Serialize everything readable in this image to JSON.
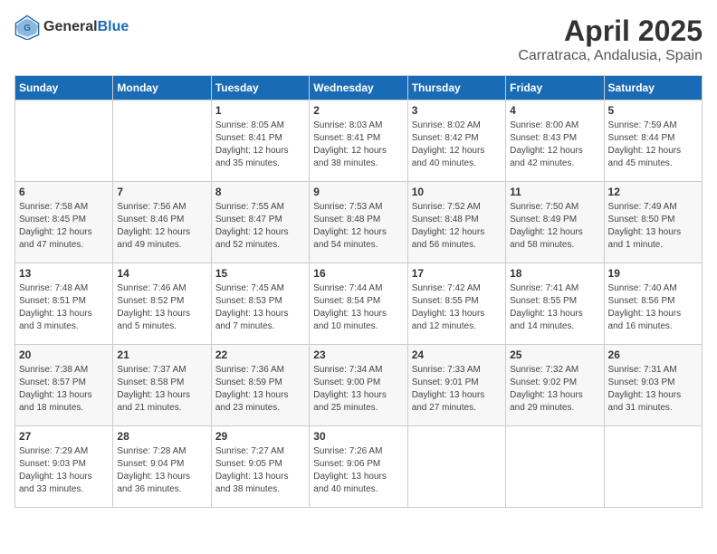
{
  "logo": {
    "general": "General",
    "blue": "Blue"
  },
  "header": {
    "title": "April 2025",
    "subtitle": "Carratraca, Andalusia, Spain"
  },
  "days_of_week": [
    "Sunday",
    "Monday",
    "Tuesday",
    "Wednesday",
    "Thursday",
    "Friday",
    "Saturday"
  ],
  "weeks": [
    [
      {
        "day": "",
        "sunrise": "",
        "sunset": "",
        "daylight": ""
      },
      {
        "day": "",
        "sunrise": "",
        "sunset": "",
        "daylight": ""
      },
      {
        "day": "1",
        "sunrise": "Sunrise: 8:05 AM",
        "sunset": "Sunset: 8:41 PM",
        "daylight": "Daylight: 12 hours and 35 minutes."
      },
      {
        "day": "2",
        "sunrise": "Sunrise: 8:03 AM",
        "sunset": "Sunset: 8:41 PM",
        "daylight": "Daylight: 12 hours and 38 minutes."
      },
      {
        "day": "3",
        "sunrise": "Sunrise: 8:02 AM",
        "sunset": "Sunset: 8:42 PM",
        "daylight": "Daylight: 12 hours and 40 minutes."
      },
      {
        "day": "4",
        "sunrise": "Sunrise: 8:00 AM",
        "sunset": "Sunset: 8:43 PM",
        "daylight": "Daylight: 12 hours and 42 minutes."
      },
      {
        "day": "5",
        "sunrise": "Sunrise: 7:59 AM",
        "sunset": "Sunset: 8:44 PM",
        "daylight": "Daylight: 12 hours and 45 minutes."
      }
    ],
    [
      {
        "day": "6",
        "sunrise": "Sunrise: 7:58 AM",
        "sunset": "Sunset: 8:45 PM",
        "daylight": "Daylight: 12 hours and 47 minutes."
      },
      {
        "day": "7",
        "sunrise": "Sunrise: 7:56 AM",
        "sunset": "Sunset: 8:46 PM",
        "daylight": "Daylight: 12 hours and 49 minutes."
      },
      {
        "day": "8",
        "sunrise": "Sunrise: 7:55 AM",
        "sunset": "Sunset: 8:47 PM",
        "daylight": "Daylight: 12 hours and 52 minutes."
      },
      {
        "day": "9",
        "sunrise": "Sunrise: 7:53 AM",
        "sunset": "Sunset: 8:48 PM",
        "daylight": "Daylight: 12 hours and 54 minutes."
      },
      {
        "day": "10",
        "sunrise": "Sunrise: 7:52 AM",
        "sunset": "Sunset: 8:48 PM",
        "daylight": "Daylight: 12 hours and 56 minutes."
      },
      {
        "day": "11",
        "sunrise": "Sunrise: 7:50 AM",
        "sunset": "Sunset: 8:49 PM",
        "daylight": "Daylight: 12 hours and 58 minutes."
      },
      {
        "day": "12",
        "sunrise": "Sunrise: 7:49 AM",
        "sunset": "Sunset: 8:50 PM",
        "daylight": "Daylight: 13 hours and 1 minute."
      }
    ],
    [
      {
        "day": "13",
        "sunrise": "Sunrise: 7:48 AM",
        "sunset": "Sunset: 8:51 PM",
        "daylight": "Daylight: 13 hours and 3 minutes."
      },
      {
        "day": "14",
        "sunrise": "Sunrise: 7:46 AM",
        "sunset": "Sunset: 8:52 PM",
        "daylight": "Daylight: 13 hours and 5 minutes."
      },
      {
        "day": "15",
        "sunrise": "Sunrise: 7:45 AM",
        "sunset": "Sunset: 8:53 PM",
        "daylight": "Daylight: 13 hours and 7 minutes."
      },
      {
        "day": "16",
        "sunrise": "Sunrise: 7:44 AM",
        "sunset": "Sunset: 8:54 PM",
        "daylight": "Daylight: 13 hours and 10 minutes."
      },
      {
        "day": "17",
        "sunrise": "Sunrise: 7:42 AM",
        "sunset": "Sunset: 8:55 PM",
        "daylight": "Daylight: 13 hours and 12 minutes."
      },
      {
        "day": "18",
        "sunrise": "Sunrise: 7:41 AM",
        "sunset": "Sunset: 8:55 PM",
        "daylight": "Daylight: 13 hours and 14 minutes."
      },
      {
        "day": "19",
        "sunrise": "Sunrise: 7:40 AM",
        "sunset": "Sunset: 8:56 PM",
        "daylight": "Daylight: 13 hours and 16 minutes."
      }
    ],
    [
      {
        "day": "20",
        "sunrise": "Sunrise: 7:38 AM",
        "sunset": "Sunset: 8:57 PM",
        "daylight": "Daylight: 13 hours and 18 minutes."
      },
      {
        "day": "21",
        "sunrise": "Sunrise: 7:37 AM",
        "sunset": "Sunset: 8:58 PM",
        "daylight": "Daylight: 13 hours and 21 minutes."
      },
      {
        "day": "22",
        "sunrise": "Sunrise: 7:36 AM",
        "sunset": "Sunset: 8:59 PM",
        "daylight": "Daylight: 13 hours and 23 minutes."
      },
      {
        "day": "23",
        "sunrise": "Sunrise: 7:34 AM",
        "sunset": "Sunset: 9:00 PM",
        "daylight": "Daylight: 13 hours and 25 minutes."
      },
      {
        "day": "24",
        "sunrise": "Sunrise: 7:33 AM",
        "sunset": "Sunset: 9:01 PM",
        "daylight": "Daylight: 13 hours and 27 minutes."
      },
      {
        "day": "25",
        "sunrise": "Sunrise: 7:32 AM",
        "sunset": "Sunset: 9:02 PM",
        "daylight": "Daylight: 13 hours and 29 minutes."
      },
      {
        "day": "26",
        "sunrise": "Sunrise: 7:31 AM",
        "sunset": "Sunset: 9:03 PM",
        "daylight": "Daylight: 13 hours and 31 minutes."
      }
    ],
    [
      {
        "day": "27",
        "sunrise": "Sunrise: 7:29 AM",
        "sunset": "Sunset: 9:03 PM",
        "daylight": "Daylight: 13 hours and 33 minutes."
      },
      {
        "day": "28",
        "sunrise": "Sunrise: 7:28 AM",
        "sunset": "Sunset: 9:04 PM",
        "daylight": "Daylight: 13 hours and 36 minutes."
      },
      {
        "day": "29",
        "sunrise": "Sunrise: 7:27 AM",
        "sunset": "Sunset: 9:05 PM",
        "daylight": "Daylight: 13 hours and 38 minutes."
      },
      {
        "day": "30",
        "sunrise": "Sunrise: 7:26 AM",
        "sunset": "Sunset: 9:06 PM",
        "daylight": "Daylight: 13 hours and 40 minutes."
      },
      {
        "day": "",
        "sunrise": "",
        "sunset": "",
        "daylight": ""
      },
      {
        "day": "",
        "sunrise": "",
        "sunset": "",
        "daylight": ""
      },
      {
        "day": "",
        "sunrise": "",
        "sunset": "",
        "daylight": ""
      }
    ]
  ]
}
